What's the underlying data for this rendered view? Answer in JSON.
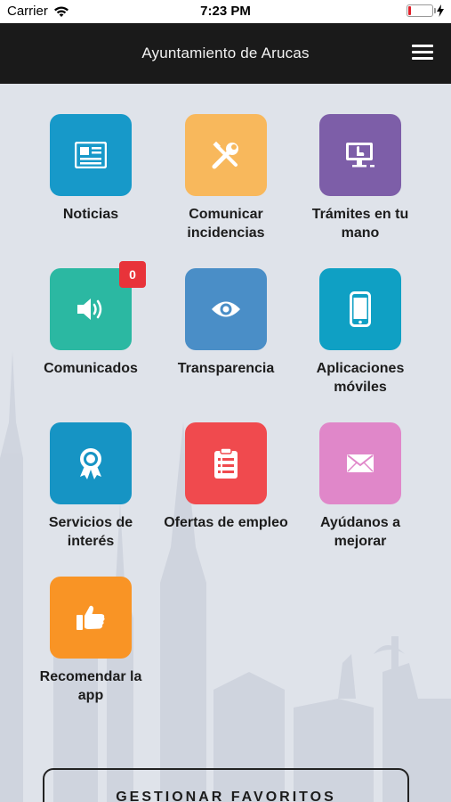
{
  "status_bar": {
    "carrier": "Carrier",
    "time": "7:23 PM"
  },
  "header": {
    "title": "Ayuntamiento de Arucas"
  },
  "tiles": [
    {
      "label": "Noticias",
      "color": "#1799c9",
      "icon": "newspaper-icon"
    },
    {
      "label": "Comunicar incidencias",
      "color": "#f8b85c",
      "icon": "tools-icon"
    },
    {
      "label": "Trámites en tu mano",
      "color": "#7d5ea8",
      "icon": "computer-hand-icon"
    },
    {
      "label": "Comunicados",
      "color": "#2bb8a2",
      "icon": "speaker-icon",
      "badge": "0"
    },
    {
      "label": "Transparencia",
      "color": "#4a8ec7",
      "icon": "eye-icon"
    },
    {
      "label": "Aplicaciones móviles",
      "color": "#0fa0c4",
      "icon": "smartphone-icon"
    },
    {
      "label": "Servicios de interés",
      "color": "#1694c4",
      "icon": "award-icon"
    },
    {
      "label": "Ofertas de empleo",
      "color": "#f04a4e",
      "icon": "clipboard-icon"
    },
    {
      "label": "Ayúdanos a mejorar",
      "color": "#e087c9",
      "icon": "envelope-icon"
    },
    {
      "label": "Recomendar la app",
      "color": "#f99425",
      "icon": "thumbs-up-icon"
    }
  ],
  "favorites_button": {
    "label": "GESTIONAR FAVORITOS"
  }
}
